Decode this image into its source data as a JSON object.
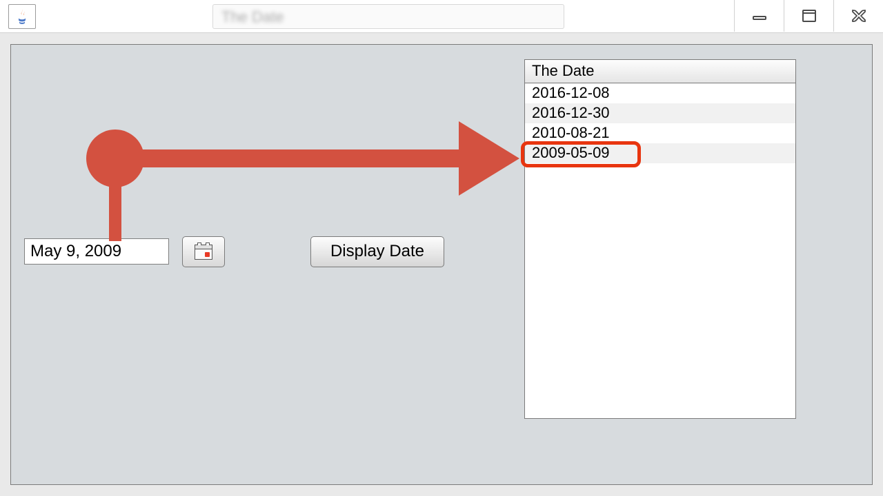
{
  "titlebar": {
    "blurred_text": "The Date"
  },
  "controls": {
    "date_input_value": "May 9, 2009",
    "display_button_label": "Display Date"
  },
  "table": {
    "header": "The Date",
    "rows": [
      "2016-12-08",
      "2016-12-30",
      "2010-08-21",
      "2009-05-09"
    ]
  },
  "annotation": {
    "arrow_color": "#d35140"
  }
}
